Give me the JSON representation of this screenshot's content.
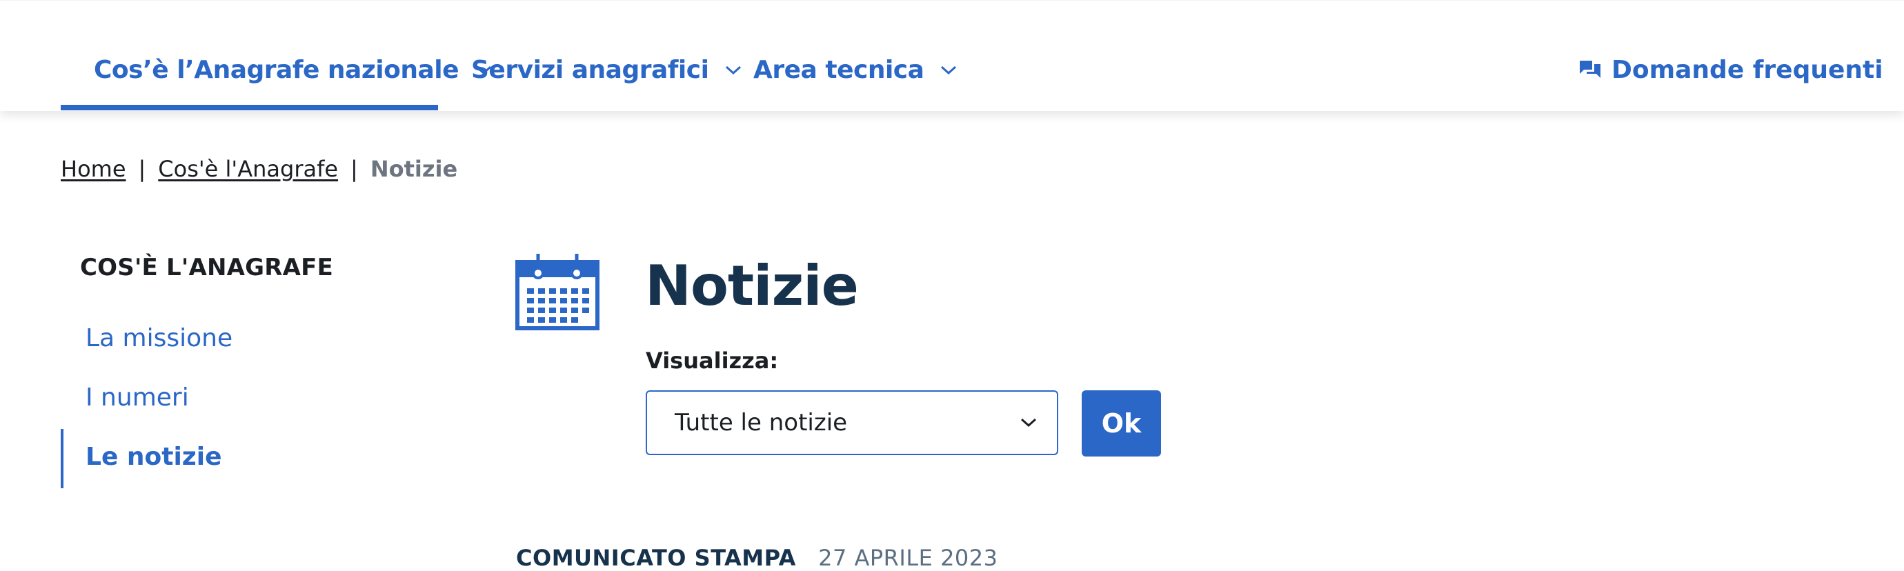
{
  "header": {
    "nav": [
      {
        "label": "Cos’è l’Anagrafe nazionale"
      },
      {
        "label": "Servizi anagrafici"
      },
      {
        "label": "Area tecnica"
      }
    ],
    "faq_label": "Domande frequenti"
  },
  "breadcrumb": {
    "items": [
      "Home",
      "Cos'è l'Anagrafe"
    ],
    "current": "Notizie",
    "separator": "|"
  },
  "sidebar": {
    "title": "COS'È L'ANAGRAFE",
    "items": [
      {
        "label": "La missione",
        "active": false
      },
      {
        "label": "I numeri",
        "active": false
      },
      {
        "label": "Le notizie",
        "active": true
      }
    ]
  },
  "main": {
    "title": "Notizie",
    "filter_label": "Visualizza:",
    "filter_value": "Tutte le notizie",
    "ok_label": "Ok",
    "first_news": {
      "category": "COMUNICATO STAMPA",
      "date": "27 APRILE 2023"
    }
  },
  "colors": {
    "accent": "#2b67c6",
    "title": "#17324d",
    "text": "#1b1e22",
    "muted": "#6d7580"
  }
}
